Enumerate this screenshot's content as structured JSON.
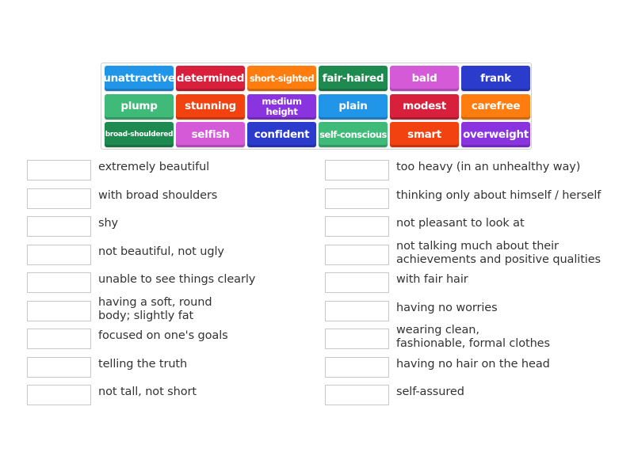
{
  "tiles": [
    {
      "label": "unattractive",
      "color": "#2196e8"
    },
    {
      "label": "determined",
      "color": "#d81f3c"
    },
    {
      "label": "short-sighted",
      "color": "#ff7d0e"
    },
    {
      "label": "fair-haired",
      "color": "#1f8a50"
    },
    {
      "label": "bald",
      "color": "#d45ad7"
    },
    {
      "label": "frank",
      "color": "#2b3ccc"
    },
    {
      "label": "plump",
      "color": "#3fba79"
    },
    {
      "label": "stunning",
      "color": "#f2420f"
    },
    {
      "label": "medium height",
      "color": "#8a34e0"
    },
    {
      "label": "plain",
      "color": "#2196e8"
    },
    {
      "label": "modest",
      "color": "#d81f3c"
    },
    {
      "label": "carefree",
      "color": "#ff7d0e"
    },
    {
      "label": "broad-shouldered",
      "color": "#1f8a50"
    },
    {
      "label": "selfish",
      "color": "#d45ad7"
    },
    {
      "label": "confident",
      "color": "#2b3ccc"
    },
    {
      "label": "self-conscious",
      "color": "#3fba79"
    },
    {
      "label": "smart",
      "color": "#f2420f"
    },
    {
      "label": "overweight",
      "color": "#8a34e0"
    }
  ],
  "definitions_left": [
    {
      "text": "extremely beautiful",
      "answer": ""
    },
    {
      "text": "with broad shoulders",
      "answer": ""
    },
    {
      "text": "shy",
      "answer": ""
    },
    {
      "text": "not beautiful, not ugly",
      "answer": ""
    },
    {
      "text": "unable to see things clearly",
      "answer": ""
    },
    {
      "text": "having a soft, round body; slightly fat",
      "line1": "having a soft, round",
      "line2": "body; slightly fat",
      "answer": ""
    },
    {
      "text": "focused on one's goals",
      "answer": ""
    },
    {
      "text": "telling the truth",
      "answer": ""
    },
    {
      "text": "not tall, not short",
      "answer": ""
    }
  ],
  "definitions_right": [
    {
      "text": "too heavy (in an unhealthy way)",
      "answer": ""
    },
    {
      "text": "thinking only about himself / herself",
      "answer": ""
    },
    {
      "text": "not pleasant to look at",
      "answer": ""
    },
    {
      "text": "not talking much about their achievements and positive qualities",
      "line1": "not talking much about their",
      "line2": "achievements and positive qualities",
      "answer": ""
    },
    {
      "text": "with fair hair",
      "answer": ""
    },
    {
      "text": "having no worries",
      "answer": ""
    },
    {
      "text": "wearing clean, fashionable, formal clothes",
      "line1": "wearing clean,",
      "line2": "fashionable, formal clothes",
      "answer": ""
    },
    {
      "text": "having no hair on the head",
      "answer": ""
    },
    {
      "text": "self-assured",
      "answer": ""
    }
  ]
}
